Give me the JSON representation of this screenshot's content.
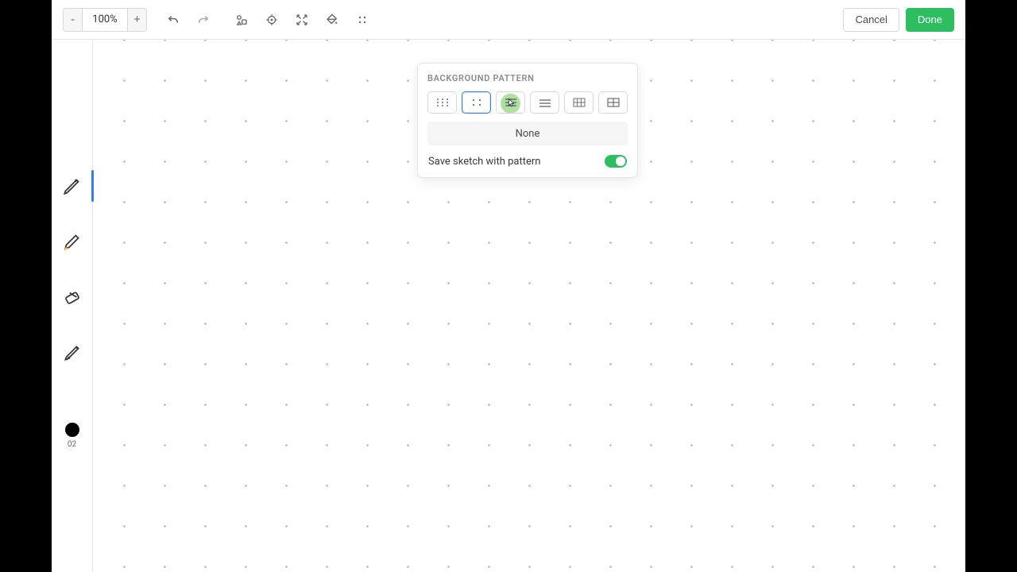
{
  "toolbar": {
    "zoom_minus": "-",
    "zoom_value": "100%",
    "zoom_plus": "+",
    "cancel_label": "Cancel",
    "done_label": "Done"
  },
  "tools": {
    "color_index": "02",
    "color_hex": "#000000"
  },
  "popover": {
    "title": "BACKGROUND PATTERN",
    "none_label": "None",
    "save_label": "Save sketch with pattern",
    "save_enabled": true,
    "patterns": [
      {
        "id": "dots-small",
        "selected": false
      },
      {
        "id": "dots-sparse",
        "selected": true
      },
      {
        "id": "lines-narrow",
        "selected": false,
        "hover": true
      },
      {
        "id": "lines-wide",
        "selected": false
      },
      {
        "id": "grid-small",
        "selected": false
      },
      {
        "id": "grid-large",
        "selected": false
      }
    ]
  }
}
